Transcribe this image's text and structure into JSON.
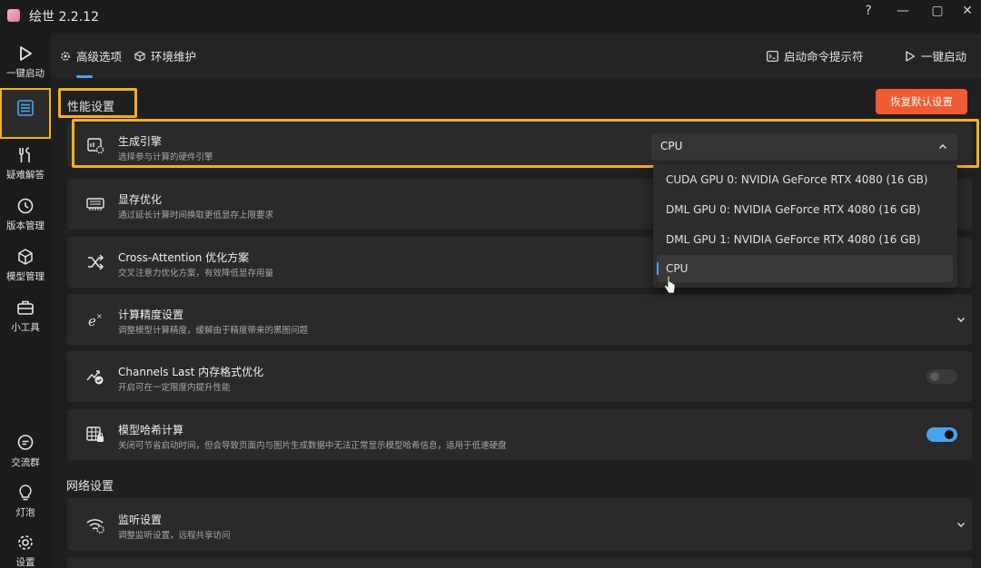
{
  "window": {
    "title": "绘世 2.2.12",
    "controls": [
      "?",
      "—",
      "▢",
      "✕"
    ]
  },
  "leftnav": {
    "items": [
      {
        "label": "一键启动",
        "icon": "play-icon"
      },
      {
        "label": "",
        "icon": "list-icon"
      },
      {
        "label": "疑难解答",
        "icon": "wrench-icon"
      },
      {
        "label": "版本管理",
        "icon": "clock-icon"
      },
      {
        "label": "模型管理",
        "icon": "cube-icon"
      },
      {
        "label": "小工具",
        "icon": "toolbox-icon"
      },
      {
        "label": "交流群",
        "icon": "chat-icon"
      },
      {
        "label": "灯泡",
        "icon": "bulb-icon"
      },
      {
        "label": "设置",
        "icon": "gear-icon"
      }
    ]
  },
  "tabs": {
    "advanced": "高级选项",
    "env": "环境维护",
    "cmd": "启动命令提示符",
    "launch": "一键启动"
  },
  "perf": {
    "section_title": "性能设置",
    "reset_label": "恢复默认设置",
    "engine": {
      "title": "生成引擎",
      "subtitle": "选择参与计算的硬件引擎",
      "selected": "CPU",
      "options": [
        "CUDA GPU 0: NVIDIA GeForce RTX 4080 (16 GB)",
        "DML GPU 0: NVIDIA GeForce RTX 4080 (16 GB)",
        "DML GPU 1: NVIDIA GeForce RTX 4080 (16 GB)",
        "CPU"
      ]
    },
    "vram": {
      "title": "显存优化",
      "subtitle": "通过延长计算时间换取更低显存上限要求"
    },
    "xattn": {
      "title": "Cross-Attention 优化方案",
      "subtitle": "交叉注意力优化方案，有效降低显存用量"
    },
    "precision": {
      "title": "计算精度设置",
      "subtitle": "调整模型计算精度，缓解由于精度带来的黑图问题"
    },
    "channels": {
      "title": "Channels Last 内存格式优化",
      "subtitle": "开启可在一定限度内提升性能",
      "enabled": false
    },
    "hash": {
      "title": "模型哈希计算",
      "subtitle": "关闭可节省启动时间，但会导致页面内与图片生成数据中无法正常显示模型哈希信息，适用于低速硬盘",
      "enabled": true
    }
  },
  "network": {
    "section_title": "网络设置",
    "listen": {
      "title": "监听设置",
      "subtitle": "调整监听设置，远程共享访问"
    }
  },
  "colors": {
    "accent": "#4aa3f0",
    "highlight": "#f2b01e",
    "reset": "#f05a35"
  }
}
